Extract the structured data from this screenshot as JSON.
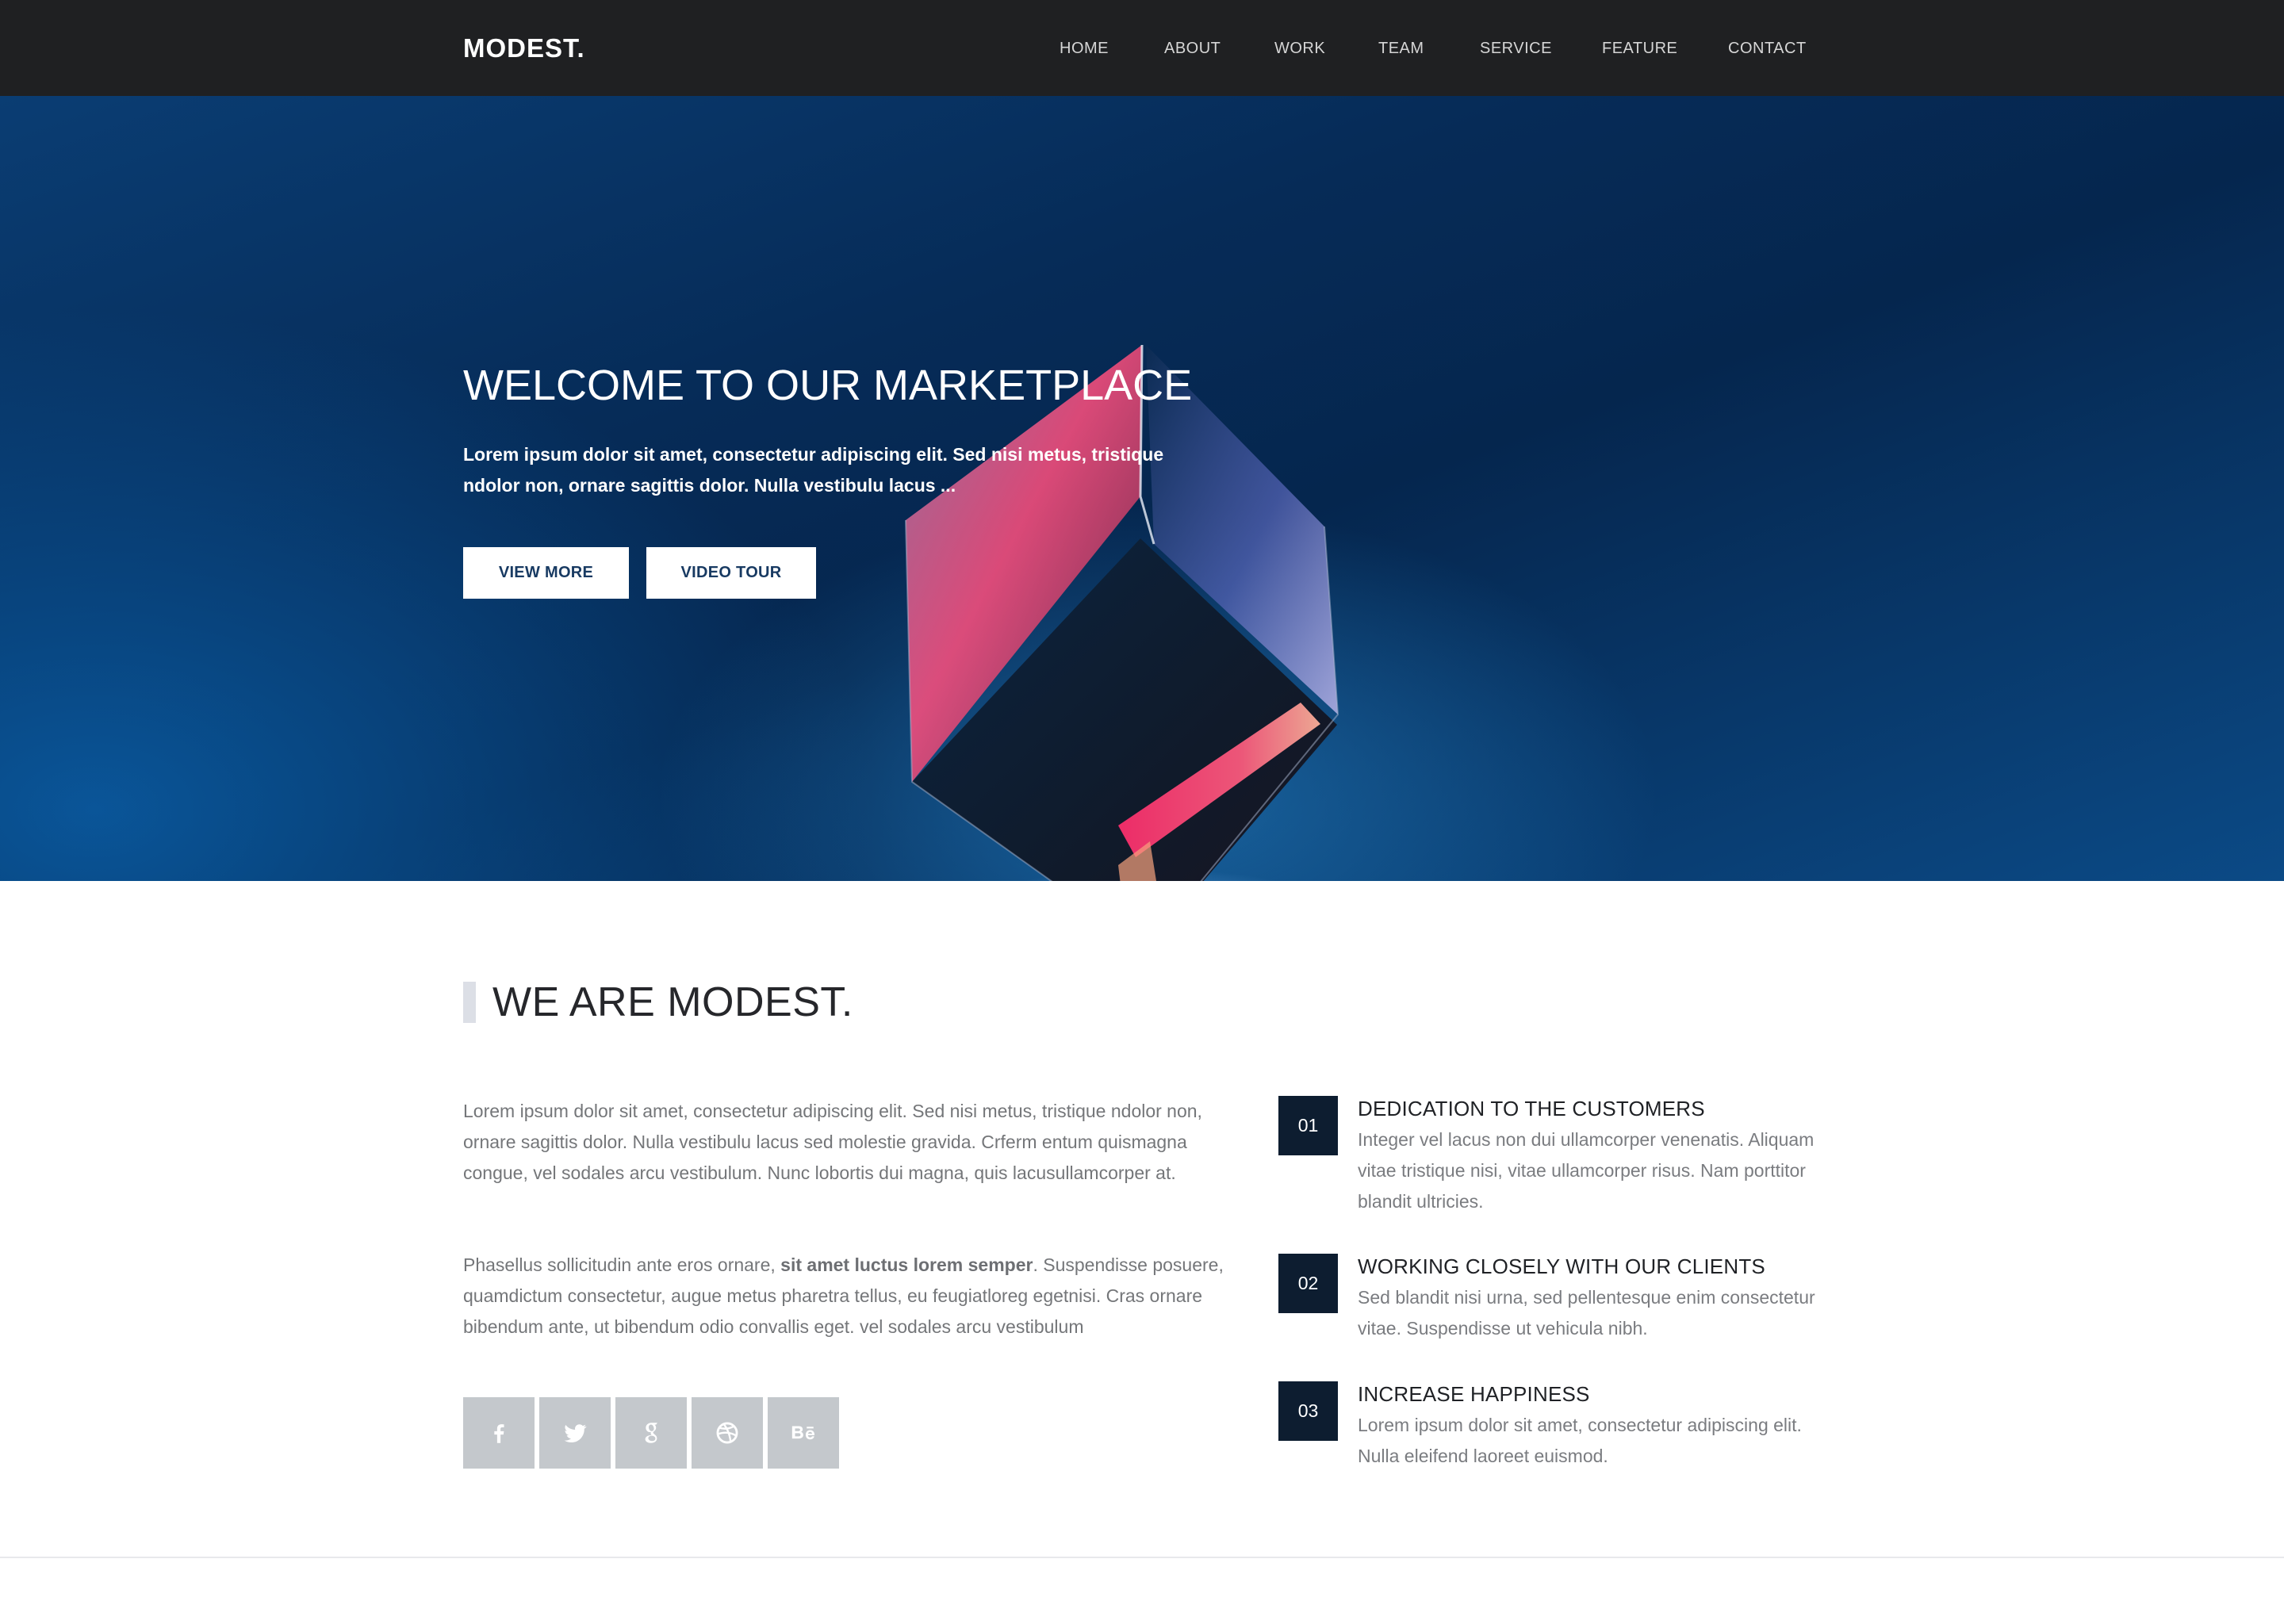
{
  "brand": {
    "logo": "MODEST."
  },
  "nav": {
    "items": [
      {
        "label": "HOME"
      },
      {
        "label": "ABOUT"
      },
      {
        "label": "WORK"
      },
      {
        "label": "TEAM"
      },
      {
        "label": "SERVICE"
      },
      {
        "label": "FEATURE"
      },
      {
        "label": "CONTACT"
      }
    ]
  },
  "hero": {
    "title": "WELCOME TO OUR MARKETPLACE",
    "text": "Lorem ipsum dolor sit amet, consectetur adipiscing elit. Sed nisi metus, tristique ndolor non, ornare sagittis dolor. Nulla vestibulu lacus ...",
    "buttons": {
      "view_more": "VIEW MORE",
      "video_tour": "VIDEO TOUR"
    }
  },
  "about": {
    "title": "WE ARE MODEST.",
    "paragraph1": "Lorem ipsum dolor sit amet, consectetur adipiscing elit. Sed nisi metus, tristique ndolor non, ornare sagittis dolor. Nulla vestibulu lacus sed molestie gravida. Crferm entum quismagna congue, vel sodales arcu vestibulum. Nunc lobortis dui magna, quis lacusullamcorper at.",
    "paragraph2": {
      "before": "Phasellus sollicitudin ante eros ornare, ",
      "bold": "sit amet luctus lorem semper",
      "after": ". Suspendisse posuere, quamdictum consectetur, augue metus pharetra tellus, eu feugiatloreg egetnisi. Cras ornare bibendum ante, ut bibendum odio convallis eget. vel sodales arcu vestibulum"
    },
    "social": [
      {
        "icon": "facebook-icon"
      },
      {
        "icon": "twitter-icon"
      },
      {
        "icon": "google-icon"
      },
      {
        "icon": "dribbble-icon"
      },
      {
        "icon": "behance-icon"
      }
    ]
  },
  "features": [
    {
      "number": "01",
      "title": "DEDICATION TO THE CUSTOMERS",
      "text": "Integer vel lacus non dui ullamcorper venenatis. Aliquam vitae tristique nisi, vitae ullamcorper risus. Nam porttitor blandit ultricies."
    },
    {
      "number": "02",
      "title": "WORKING CLOSELY WITH OUR CLIENTS",
      "text": "Sed blandit nisi urna, sed pellentesque enim consectetur vitae. Suspendisse ut vehicula nibh."
    },
    {
      "number": "03",
      "title": "INCREASE HAPPINESS",
      "text": "Lorem ipsum dolor sit amet, consectetur adipiscing elit. Nulla eleifend laoreet euismod."
    }
  ],
  "colors": {
    "navbar": "#1f2022",
    "hero_blue": "#062b57",
    "feature_badge": "#0d1d30",
    "social_tile": "#c4c8cc"
  }
}
